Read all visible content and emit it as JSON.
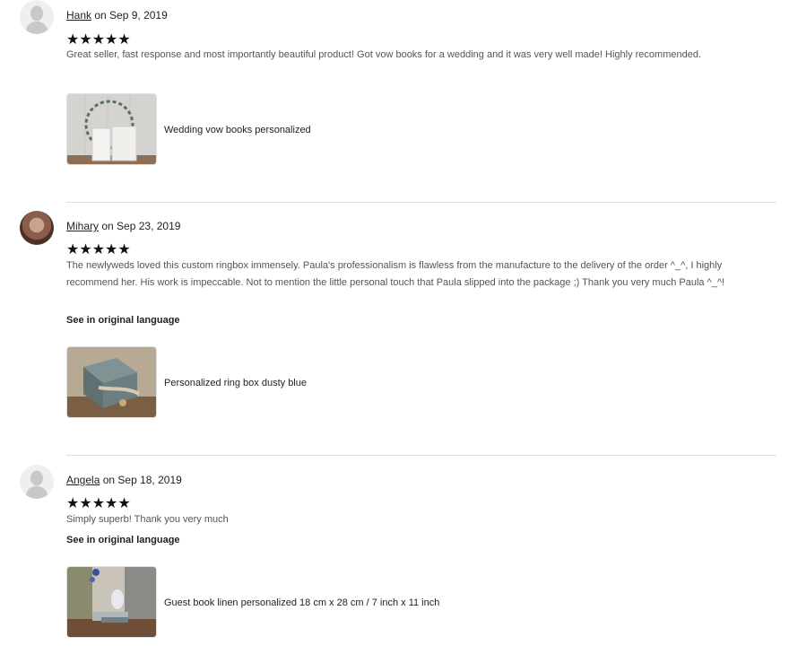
{
  "reviews": [
    {
      "reviewer": "Hank",
      "date_text": "on Sep 9, 2019",
      "stars": "★★★★★",
      "rating": 5,
      "text": "Great seller, fast response and most importantly beautiful product! Got vow books for a wedding and it was very well made! Highly recommended.",
      "see_original": "",
      "product": "Wedding vow books personalized"
    },
    {
      "reviewer": "Mihary",
      "date_text": "on Sep 23, 2019",
      "stars": "★★★★★",
      "rating": 5,
      "text": "The newlyweds loved this custom ringbox immensely. Paula's professionalism is flawless from the manufacture to the delivery of the order ^_^, I highly recommend her. His work is impeccable. Not to mention the little personal touch that Paula slipped into the package ;) Thank you very much Paula ^_^!",
      "see_original": "See in original language",
      "product": "Personalized ring box dusty blue"
    },
    {
      "reviewer": "Angela",
      "date_text": "on Sep 18, 2019",
      "stars": "★★★★★",
      "rating": 5,
      "text": "Simply superb! Thank you very much",
      "see_original": "See in original language",
      "product": "Guest book linen personalized 18 cm x 28 cm / 7 inch x 11 inch"
    }
  ],
  "icons": {
    "avatar_default": "person-silhouette-icon",
    "rating": "star-icon"
  }
}
